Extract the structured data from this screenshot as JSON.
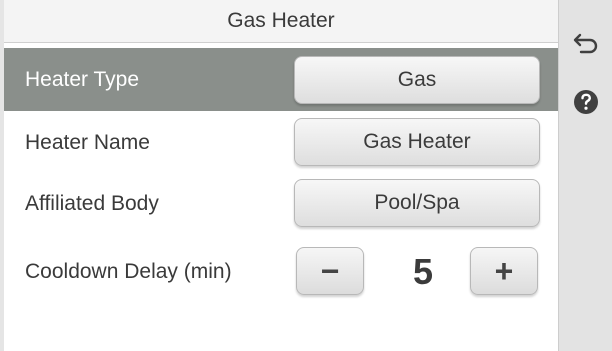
{
  "title": "Gas Heater",
  "rows": {
    "heater_type": {
      "label": "Heater Type",
      "value": "Gas"
    },
    "heater_name": {
      "label": "Heater Name",
      "value": "Gas Heater"
    },
    "affiliated_body": {
      "label": "Affiliated Body",
      "value": "Pool/Spa"
    },
    "cooldown_delay": {
      "label": "Cooldown Delay (min)",
      "value": "5",
      "minus": "−",
      "plus": "+"
    }
  },
  "icons": {
    "back": "back-arrow-icon",
    "help": "help-icon"
  },
  "colors": {
    "selected_row": "#8a8f8b",
    "panel_bg": "#ffffff",
    "rail_bg": "#e3e3e3",
    "text": "#3a3a3a"
  }
}
